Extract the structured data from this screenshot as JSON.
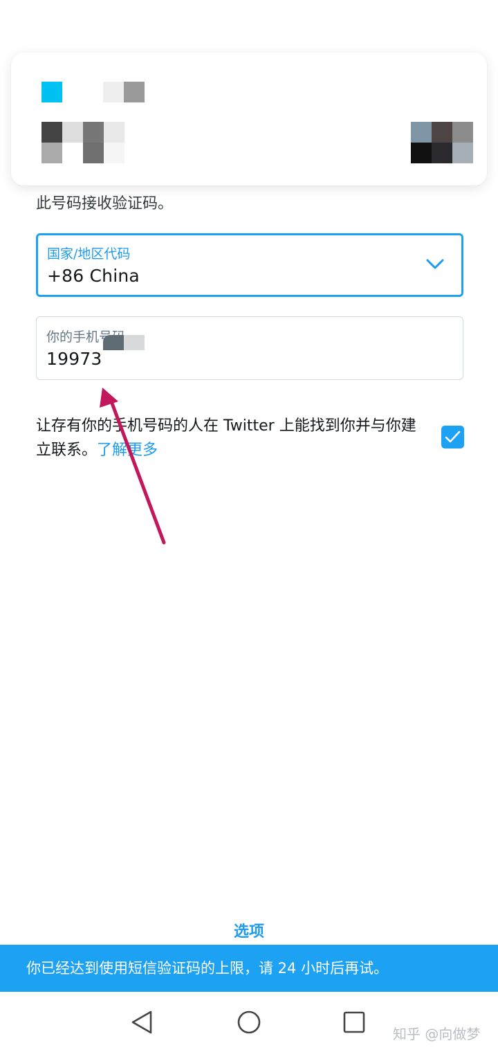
{
  "phone_prompt": {
    "subtitle": "此号码接收验证码。"
  },
  "country_field": {
    "label": "国家/地区代码",
    "value": "+86 China",
    "icon": "chevron-down-icon"
  },
  "phone_field": {
    "label": "你的手机号码",
    "value": "19973"
  },
  "consent": {
    "text": "让存有你的手机号码的人在 Twitter 上能找到你并与你建立联系。",
    "learn_more": "了解更多",
    "checked": true
  },
  "options_label": "选项",
  "toast_message": "你已经达到使用短信验证码的上限，请 24 小时后再试。",
  "watermark": "知乎 @向做梦",
  "colors": {
    "accent": "#1da1f2",
    "annotation_arrow": "#c2185b"
  }
}
